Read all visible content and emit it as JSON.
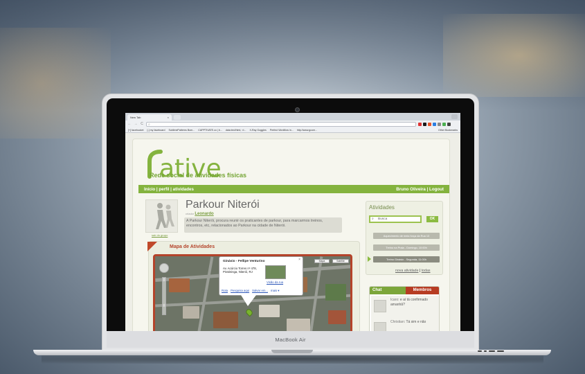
{
  "device": {
    "label": "MacBook Air"
  },
  "browser": {
    "tab_title": "New Tab",
    "tab_close": "×",
    "nav": {
      "back": "←",
      "forward": "→",
      "reload": "C"
    },
    "address_value": "",
    "bookmarks": [
      "[+] facebucket",
      "[-] my faceboard",
      "SublimePatterns Bom...",
      "CAPPTIVATE.co | b...",
      "data:text/html, <t...",
      "X-Ray Goggles",
      "Perfect Workflow in...",
      "http://www.gcom..."
    ],
    "other_bookmarks": "Other Bookmarks",
    "extension_colors": [
      "#d33",
      "#1a1a1a",
      "#e5542a",
      "#2a7de1",
      "#888",
      "#4caf50",
      "#444"
    ]
  },
  "site": {
    "logo_text": "ative",
    "tagline": "Rede social de atividades físicas",
    "nav_left": "Início | perfil | atividades",
    "nav_right": "Bruno Oliveira | Logout",
    "accent_green": "#84b33e",
    "accent_red": "#b4432a"
  },
  "group": {
    "title": "Parkour Niterói",
    "creator_prefix": "criador",
    "creator_name": "Leonardo",
    "avatar_caption": "sair do grupo",
    "description": "A Parkour Niterói, procura reunir os praticantes de parkour, para marcarmos treinos, encontros, etc, relacionados ao Parkour na cidade de Niterói."
  },
  "map_panel": {
    "title": "Mapa de Atividades",
    "map_type_buttons": [
      "Mapa",
      "Satélite"
    ],
    "popup": {
      "title": "Ginásio - Fellipe Venturino",
      "address_line1": "Av. Acúrcio Torres nº 478,",
      "address_line2": "Piratininga, Niterói, RJ",
      "street_view": "Visão da rua",
      "links": [
        "Rota",
        "Pesquisa aqui",
        "Salvar em...",
        "mais ▾"
      ]
    }
  },
  "activities": {
    "title": "Atividades",
    "search_placeholder": "Busca",
    "ok_label": "OK",
    "items": [
      "Aquecimento de meia força da Rua 13",
      "Treino na Praia - Domingo, 10:00h",
      "Treino Ginásio - Segunda, 11:00h"
    ],
    "link_new": "nova atividade",
    "link_sep": "|",
    "link_all": "todas"
  },
  "chat": {
    "chat_label": "Chat",
    "members_label": "Membros",
    "messages": [
      {
        "author": "Icaro:",
        "text": "e aí tá confirmado amanhã?"
      },
      {
        "author": "Christian:",
        "text": "Tá sim e não"
      }
    ]
  }
}
